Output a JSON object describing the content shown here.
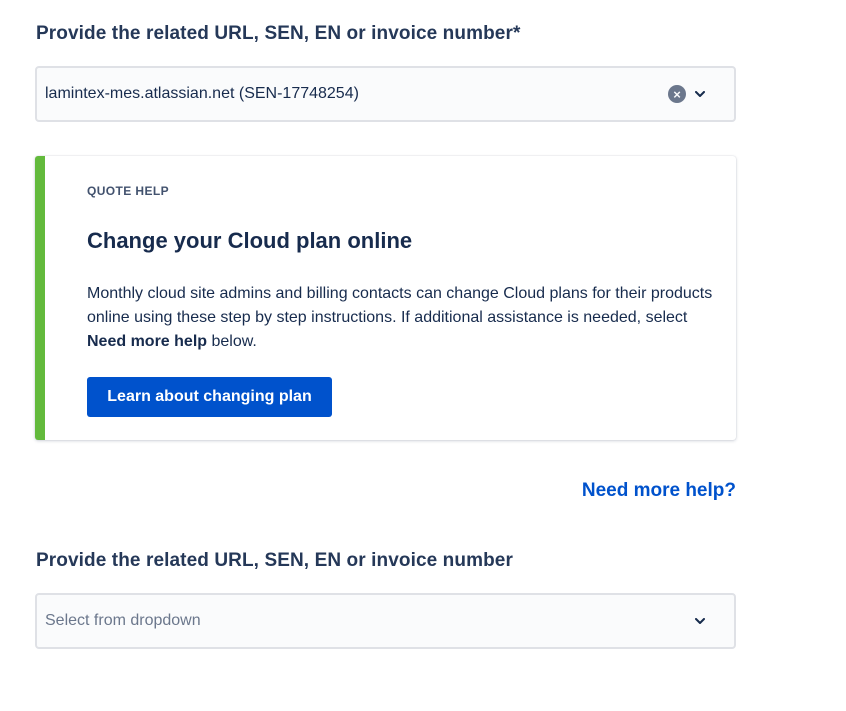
{
  "field1": {
    "label": "Provide the related URL, SEN, EN or invoice number*",
    "value": "lamintex-mes.atlassian.net (SEN-17748254)"
  },
  "card": {
    "eyebrow": "QUOTE HELP",
    "title": "Change your Cloud plan online",
    "body_prefix": "Monthly cloud site admins and billing contacts can change Cloud plans for their products online using these step by step instructions. If additional assistance is needed, select ",
    "body_bold": "Need more help",
    "body_suffix": " below.",
    "button_label": "Learn about changing plan",
    "accent_color": "#63ba3c"
  },
  "help_link": "Need more help?",
  "field2": {
    "label": "Provide the related URL, SEN, EN or invoice number",
    "placeholder": "Select from dropdown"
  },
  "icons": {
    "clear": "clear-icon",
    "chevron": "chevron-down-icon"
  }
}
